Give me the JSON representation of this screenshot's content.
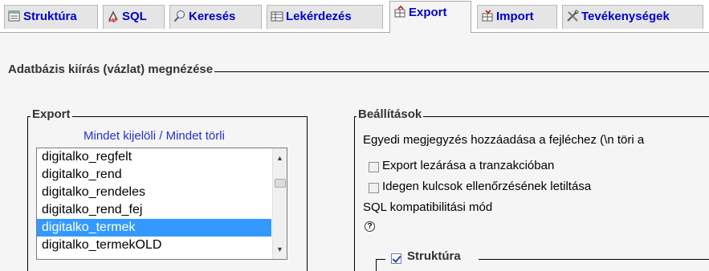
{
  "tabs": [
    {
      "label": "Struktúra",
      "icon": "structure-icon"
    },
    {
      "label": "SQL",
      "icon": "sql-icon"
    },
    {
      "label": "Keresés",
      "icon": "search-icon"
    },
    {
      "label": "Lekérdezés",
      "icon": "query-icon"
    },
    {
      "label": "Export",
      "icon": "export-icon",
      "active": true
    },
    {
      "label": "Import",
      "icon": "import-icon"
    },
    {
      "label": "Tevékenységek",
      "icon": "tools-icon"
    }
  ],
  "main_legend": "Adatbázis kiírás (vázlat) megnézése",
  "export": {
    "legend": "Export",
    "select_all": "Mindet kijelöli",
    "separator": "/",
    "deselect_all": "Mindet törli",
    "tables": [
      "digitalko_regfelt",
      "digitalko_rend",
      "digitalko_rendeles",
      "digitalko_rend_fej",
      "digitalko_termek",
      "digitalko_termekOLD"
    ],
    "selected": "digitalko_termek"
  },
  "settings": {
    "legend": "Beállítások",
    "header_comment": "Egyedi megjegyzés hozzáadása a fejléchez (\\n töri a",
    "transaction_label": "Export lezárása a tranzakcióban",
    "transaction_checked": false,
    "fk_label": "Idegen kulcsok ellenőrzésének letiltása",
    "fk_checked": false,
    "sql_compat_label": "SQL kompatibilitási mód",
    "help_symbol": "?",
    "structure_label": "Struktúra",
    "structure_checked": true
  },
  "colors": {
    "link": "#0000cc",
    "selection": "#3399ff",
    "background": "#f5f5f5"
  }
}
